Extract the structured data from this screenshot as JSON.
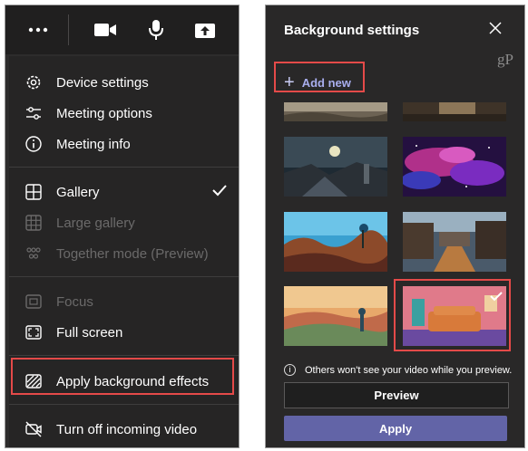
{
  "toolbar": {
    "items": [
      {
        "name": "more-options",
        "icon": "ellipsis-icon"
      },
      {
        "name": "camera",
        "icon": "video-camera-icon"
      },
      {
        "name": "microphone",
        "icon": "microphone-icon"
      },
      {
        "name": "share",
        "icon": "share-tray-icon"
      }
    ]
  },
  "menu": {
    "device_settings": "Device settings",
    "meeting_options": "Meeting options",
    "meeting_info": "Meeting info",
    "gallery": "Gallery",
    "large_gallery": "Large gallery",
    "together_mode": "Together mode (Preview)",
    "focus": "Focus",
    "full_screen": "Full screen",
    "apply_background_effects": "Apply background effects",
    "turn_off_incoming_video": "Turn off incoming video"
  },
  "background_settings": {
    "title": "Background settings",
    "add_new": "Add new",
    "watermark": "gP",
    "note": "Others won't see your video while you preview.",
    "preview_label": "Preview",
    "apply_label": "Apply",
    "thumbnails": [
      {
        "name": "thumb-desert-partial"
      },
      {
        "name": "thumb-ruins-partial"
      },
      {
        "name": "thumb-space-station"
      },
      {
        "name": "thumb-nebula"
      },
      {
        "name": "thumb-alien-planet"
      },
      {
        "name": "thumb-village-street"
      },
      {
        "name": "thumb-sunset-hills"
      },
      {
        "name": "thumb-living-room",
        "selected": true
      }
    ]
  },
  "colors": {
    "accent": "#6264a7",
    "highlight_red": "#e44a49",
    "menu_bg": "#262525"
  }
}
